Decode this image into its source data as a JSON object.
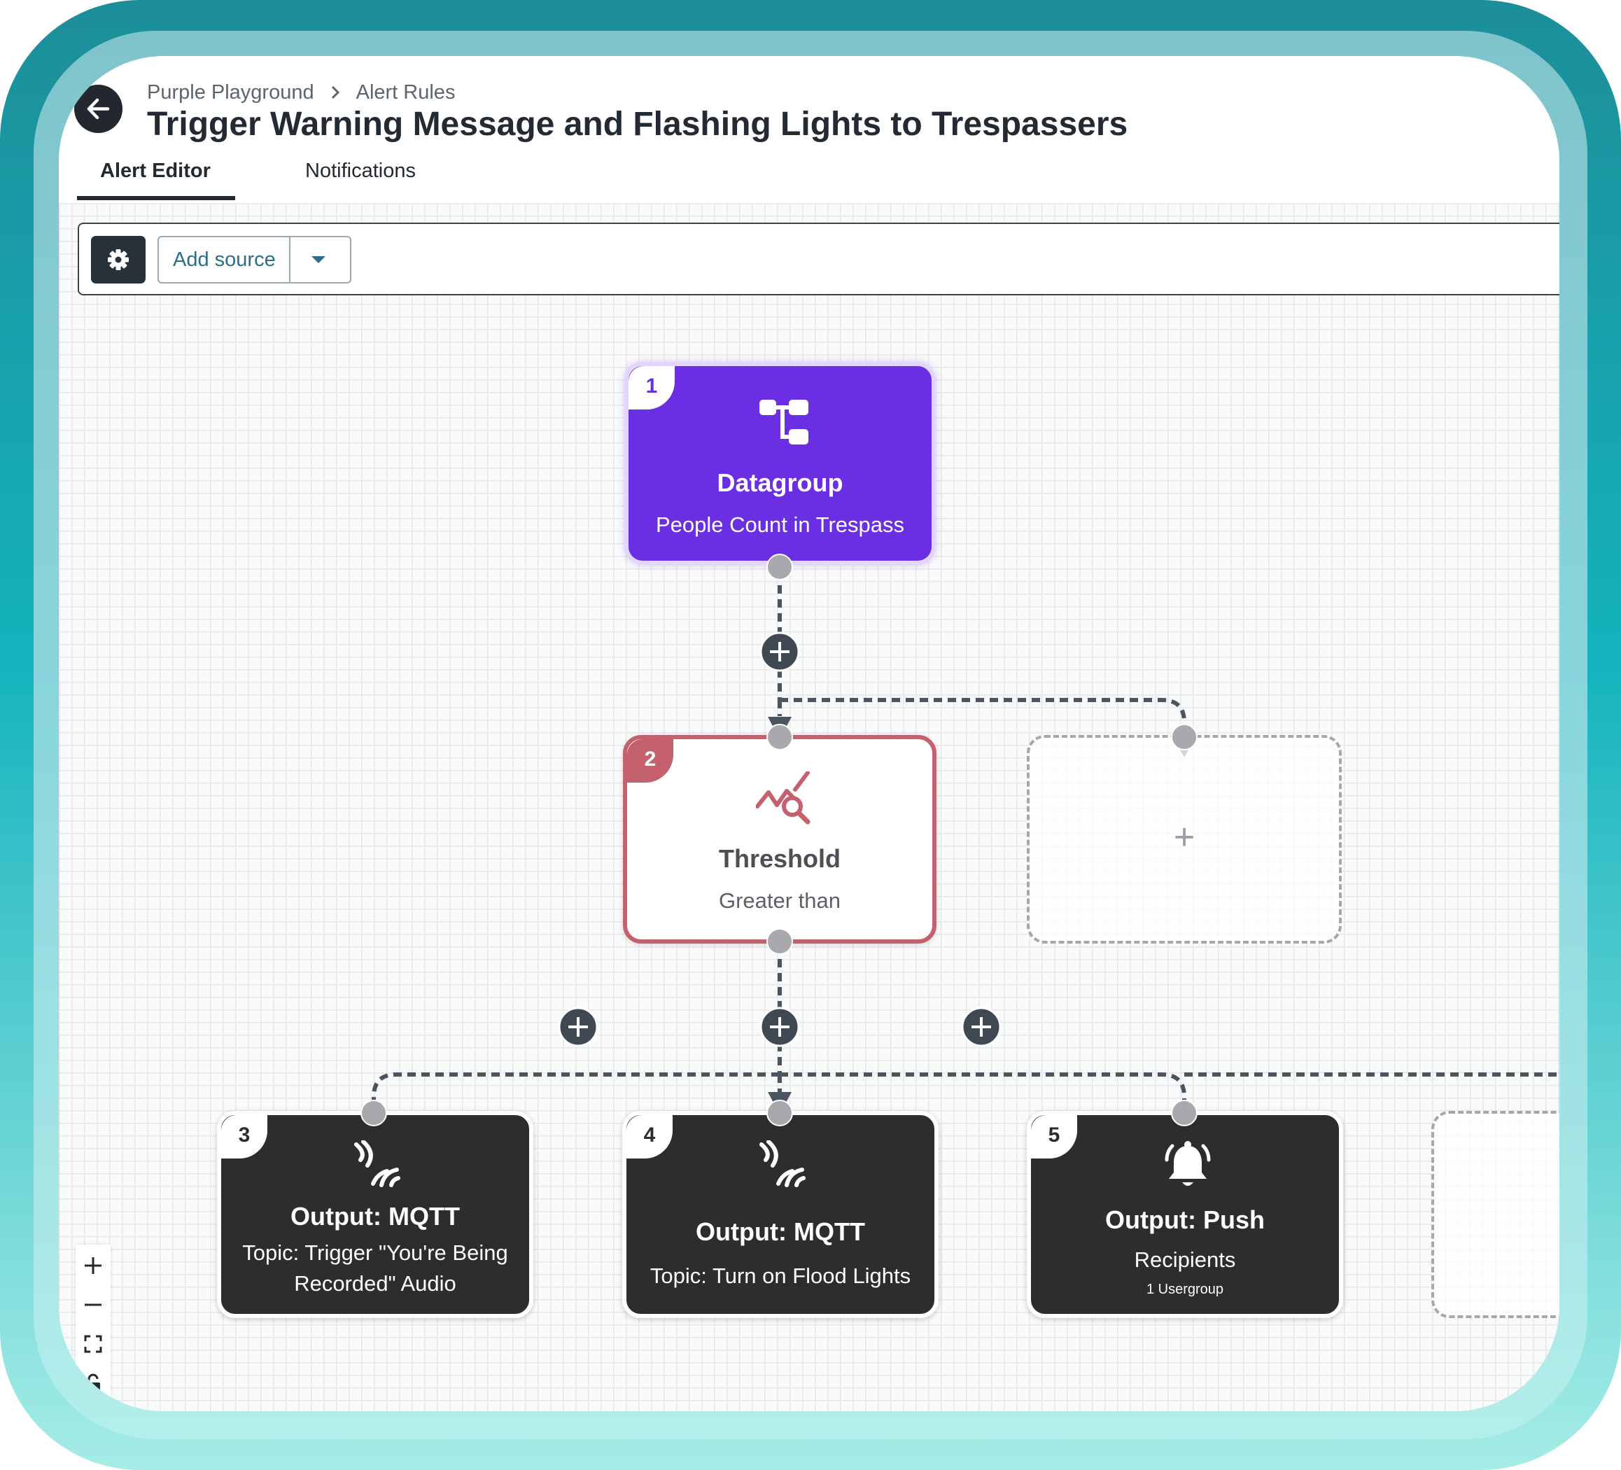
{
  "header": {
    "breadcrumbs": [
      "Purple Playground",
      "Alert Rules"
    ],
    "title": "Trigger Warning Message and Flashing Lights to Trespassers"
  },
  "tabs": [
    {
      "label": "Alert Editor",
      "active": true
    },
    {
      "label": "Notifications",
      "active": false
    }
  ],
  "toolbar": {
    "add_source_label": "Add source"
  },
  "nodes": [
    {
      "number": "1",
      "title": "Datagroup",
      "subtitle": "People Count in Trespass",
      "icon": "datagroup-icon"
    },
    {
      "number": "2",
      "title": "Threshold",
      "subtitle": "Greater than",
      "icon": "threshold-icon"
    },
    {
      "number": "3",
      "title": "Output: MQTT",
      "subtitle": "Topic: Trigger \"You're Being Recorded\" Audio",
      "subtitle_lines": [
        "Topic: Trigger \"You're Being",
        "Recorded\" Audio"
      ],
      "icon": "mqtt-icon"
    },
    {
      "number": "4",
      "title": "Output: MQTT",
      "subtitle": "Topic: Turn on Flood Lights",
      "icon": "mqtt-icon"
    },
    {
      "number": "5",
      "title": "Output: Push",
      "subtitle": "Recipients",
      "detail": "1 Usergroup",
      "icon": "bell-icon"
    }
  ],
  "placeholders": {
    "add_symbol": "+"
  },
  "colors": {
    "datagroup": "#6a2ee3",
    "threshold_border": "#c5606f",
    "output": "#2d2d2d",
    "connector": "#4b5560",
    "handle": "#a9a9ad",
    "frame_outer": "#1aa6b0",
    "frame_inner": "#8ad6dd"
  },
  "zoom_controls": [
    "zoom-in",
    "zoom-out",
    "fit-view",
    "lock"
  ]
}
